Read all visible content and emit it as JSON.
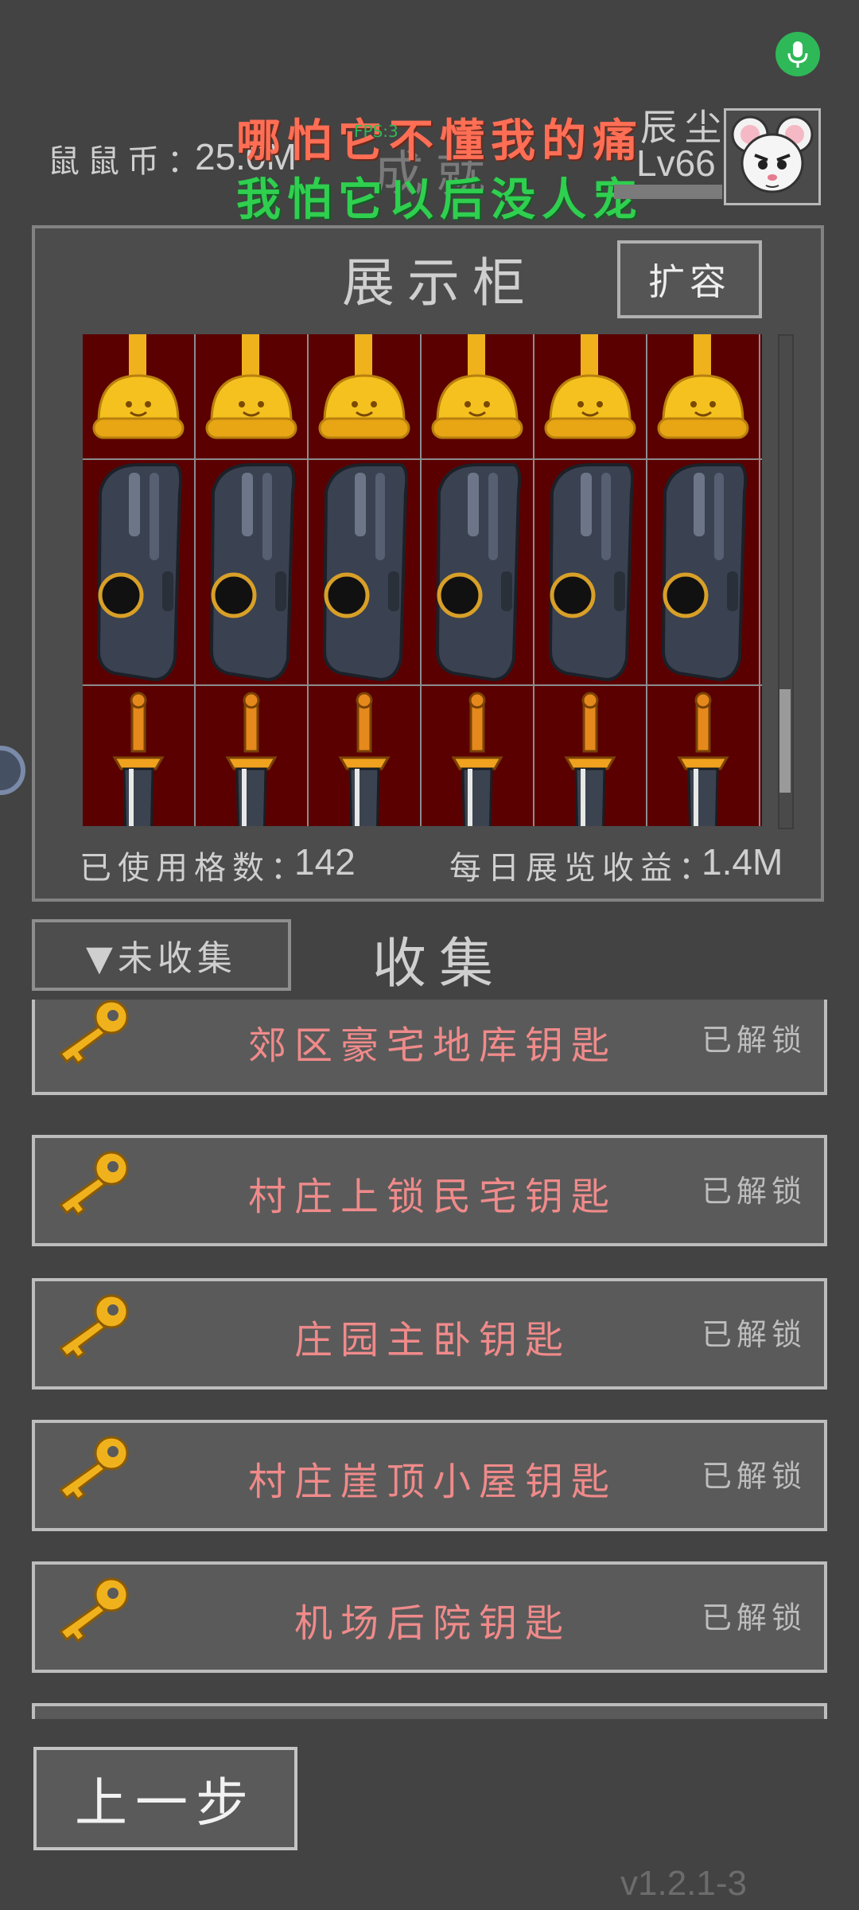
{
  "header": {
    "coin_label": "鼠鼠币：",
    "coin_value": "25.0M",
    "title": "成就",
    "fps_text": "FPS:3",
    "lyric_line1": "哪怕它不懂我的痛",
    "lyric_line2": "我怕它以后没人宠",
    "player_name": "辰尘",
    "player_level": "Lv66",
    "avatar_icon": "white-mouse-avatar"
  },
  "showcase": {
    "title": "展示柜",
    "expand_label": "扩容",
    "used_label": "已使用格数：",
    "used_value": "142",
    "income_label": "每日展览收益：",
    "income_value": "1.4M",
    "rows": [
      {
        "item_icon": "golden-trophy-icon",
        "count": 6
      },
      {
        "item_icon": "dark-gear-device-icon",
        "count": 6
      },
      {
        "item_icon": "golden-sword-icon",
        "count": 6
      }
    ]
  },
  "collection": {
    "filter_label": "▼未收集",
    "title": "收集",
    "items": [
      {
        "name": "郊区豪宅地库钥匙",
        "status": "已解锁",
        "icon": "gold-key-icon"
      },
      {
        "name": "村庄上锁民宅钥匙",
        "status": "已解锁",
        "icon": "gold-key-icon"
      },
      {
        "name": "庄园主卧钥匙",
        "status": "已解锁",
        "icon": "gold-key-icon"
      },
      {
        "name": "村庄崖顶小屋钥匙",
        "status": "已解锁",
        "icon": "gold-key-icon"
      },
      {
        "name": "机场后院钥匙",
        "status": "已解锁",
        "icon": "gold-key-icon"
      }
    ]
  },
  "footer": {
    "back_label": "上一步",
    "version": "v1.2.1-3"
  },
  "colors": {
    "background": "#434343",
    "accent_green": "#2fb857",
    "item_name": "#f08a8a",
    "grid_bg": "#5b0000"
  }
}
